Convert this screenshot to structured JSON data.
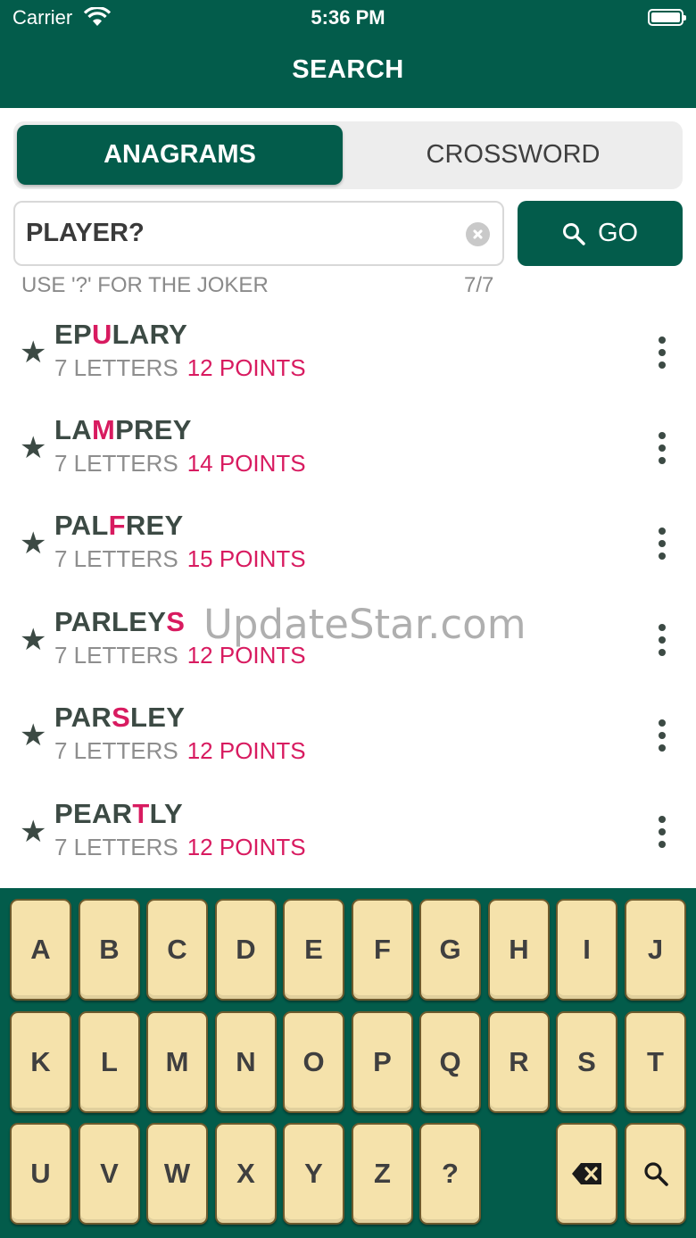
{
  "status_bar": {
    "carrier": "Carrier",
    "time": "5:36 PM"
  },
  "header": {
    "title": "SEARCH"
  },
  "tabs": [
    {
      "label": "ANAGRAMS",
      "active": true
    },
    {
      "label": "CROSSWORD",
      "active": false
    }
  ],
  "search": {
    "value": "PLAYER?",
    "go_label": "GO",
    "hint": "USE '?' FOR THE JOKER",
    "counter": "7/7"
  },
  "results": [
    {
      "pre": "EP",
      "joker": "U",
      "post": "LARY",
      "letters": "7 LETTERS",
      "points": "12 POINTS"
    },
    {
      "pre": "LA",
      "joker": "M",
      "post": "PREY",
      "letters": "7 LETTERS",
      "points": "14 POINTS"
    },
    {
      "pre": "PAL",
      "joker": "F",
      "post": "REY",
      "letters": "7 LETTERS",
      "points": "15 POINTS"
    },
    {
      "pre": "PARLEY",
      "joker": "S",
      "post": "",
      "letters": "7 LETTERS",
      "points": "12 POINTS"
    },
    {
      "pre": "PAR",
      "joker": "S",
      "post": "LEY",
      "letters": "7 LETTERS",
      "points": "12 POINTS"
    },
    {
      "pre": "PEAR",
      "joker": "T",
      "post": "LY",
      "letters": "7 LETTERS",
      "points": "12 POINTS"
    }
  ],
  "watermark": "UpdateStar.com",
  "keyboard": {
    "row1": [
      "A",
      "B",
      "C",
      "D",
      "E",
      "F",
      "G",
      "H",
      "I",
      "J"
    ],
    "row2": [
      "K",
      "L",
      "M",
      "N",
      "O",
      "P",
      "Q",
      "R",
      "S",
      "T"
    ],
    "row3": [
      "U",
      "V",
      "W",
      "X",
      "Y",
      "Z",
      "?"
    ],
    "icons": [
      "backspace-icon",
      "search-icon"
    ]
  },
  "colors": {
    "primary": "#035c4b",
    "joker": "#d81b60",
    "key": "#f5e2ab"
  }
}
